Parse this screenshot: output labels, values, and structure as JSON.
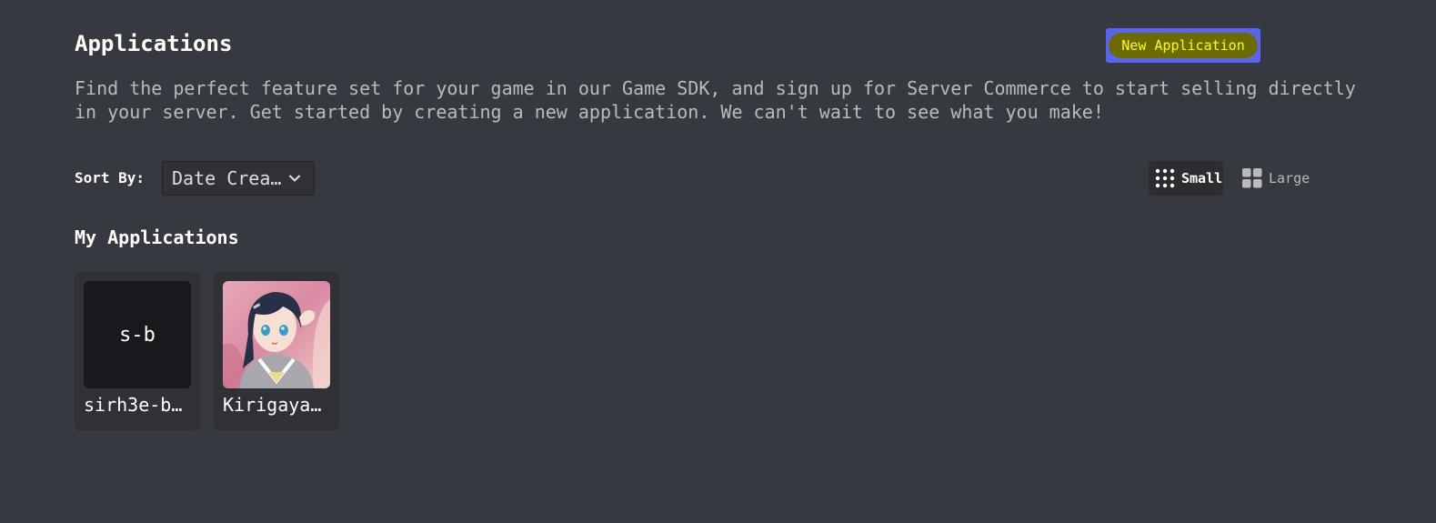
{
  "header": {
    "title": "Applications",
    "new_app_label": "New Application",
    "description": "Find the perfect feature set for your game in our Game SDK, and sign up for Server Commerce to start selling directly in your server. Get started by creating a new application. We can't wait to see what you make!"
  },
  "sort": {
    "label": "Sort By:",
    "selected": "Date Crea…"
  },
  "view": {
    "small_label": "Small",
    "large_label": "Large",
    "selected": "Small"
  },
  "my_apps": {
    "title": "My Applications",
    "items": [
      {
        "name": "sirh3e-b…",
        "initials": "s-b",
        "icon": "initials-tile"
      },
      {
        "name": "Kirigaya…",
        "initials": "",
        "icon": "anime-avatar-image"
      }
    ]
  },
  "colors": {
    "background": "#36393f",
    "card": "#2f3136",
    "brand": "#5865f2",
    "highlight_bg": "#6b6b00",
    "highlight_text": "#ffff00"
  }
}
